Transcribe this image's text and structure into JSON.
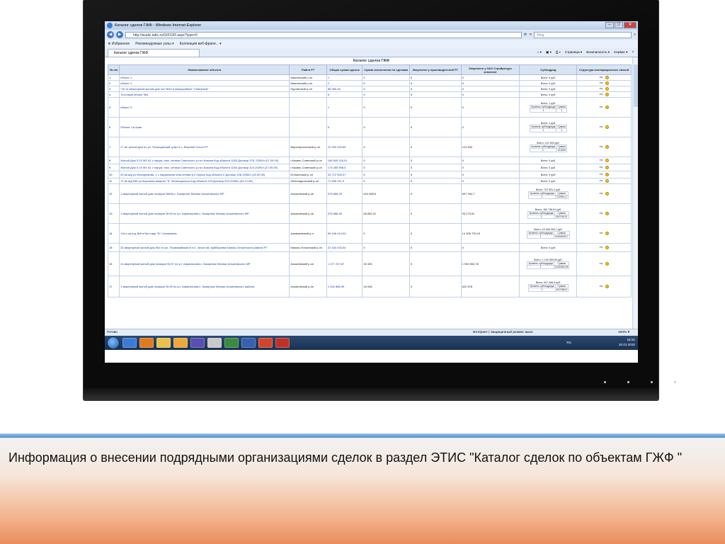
{
  "window": {
    "title": "Каталог сделок ГЖФ - Windows Internet Explorer",
    "min": "–",
    "max": "□",
    "close": "✕"
  },
  "address": {
    "url": "http://avalic.tattc.ru/GIF/GIF.aspx?type=0",
    "search_placeholder": "Bing"
  },
  "favorites": {
    "label": "Избранное",
    "item1": "Рекомендуемые узлы ▾",
    "item2": "Коллекция веб-фрагм... ▾"
  },
  "tab": {
    "label": "Каталог сделок ГЖФ"
  },
  "toolbar": {
    "page": "Страница ▾",
    "security": "Безопасность ▾",
    "service": "Сервис ▾"
  },
  "page_title": "Каталог сделок ГЖФ",
  "columns": [
    "№ п/п",
    "Наименование объекта",
    "Район РТ",
    "Общая сумма сделок",
    "Сумма исполнения по сделкам",
    "Закуплено у производителей РТ",
    "Закуплено у ЗАО Стройресурс комплект",
    "Субподряд",
    "Структура кооперационных связей"
  ],
  "rows": [
    {
      "n": "1",
      "name": "объект 1",
      "area": "Бавлинский р-он",
      "sum": "1",
      "exec": "0",
      "rt": "0",
      "zao": "0",
      "sub": "Всего: 0 руб."
    },
    {
      "n": "2",
      "name": "объект 2",
      "area": "Бавлинский р-он",
      "sum": "2",
      "exec": "0",
      "rt": "0",
      "zao": "0",
      "sub": "Всего: 0 руб."
    },
    {
      "n": "3",
      "name": "\"20-ти квартирный жилой дом поз №10 в микрорайоне \"Северный\"",
      "area": "Нурлатский р-он",
      "sum": "88 365,28",
      "exec": "0",
      "rt": "0",
      "zao": "0",
      "sub": "Всего: 0 руб."
    },
    {
      "n": "4",
      "name": "Тестовый объект №4",
      "area": "",
      "sum": "5",
      "exec": "0",
      "rt": "0",
      "zao": "0",
      "sub": "Всего: 0 руб."
    },
    {
      "n": "5",
      "name": "объект 3",
      "area": "",
      "sum": "1",
      "exec": "0",
      "rt": "0",
      "zao": "0",
      "sub": "Всего: 1 руб.",
      "level": "1",
      "amount": "1"
    },
    {
      "n": "6",
      "name": "Объект Са-ерия",
      "area": "",
      "sum": "5",
      "exec": "0",
      "rt": "0",
      "zao": "0",
      "sub": "Всего: 1 руб.",
      "level": "1",
      "amount": "1"
    },
    {
      "n": "7",
      "name": "27 кв. жилой дом по ул. Печищинский тракт в с. Верхний Услон РТ",
      "area": "Верхнеуслонский р-он",
      "sum": "22 993 339,69",
      "exec": "0",
      "rt": "0",
      "zao": "121 500",
      "sub": "Всего: 121 500 руб.",
      "level": "1",
      "amount": "121500"
    },
    {
      "n": "8",
      "name": "Жилой Дом 5-20 МЗ А1 с наруж. инж. сетями Советского р-на г.Казани Код объекта 1283 Договор 378 -2009/л (07.05.09)",
      "area": "г.Казань Советский р-он",
      "sum": "166 845 118,01",
      "exec": "0",
      "rt": "0",
      "zao": "0",
      "sub": "Всего: 0 руб."
    },
    {
      "n": "9",
      "name": "Жилой Дом 5-19 МЗ А1 с наруж. инж. сетями Советского р-на г.Казани Код объекта 1284 Договор 424-2009/л (27.05.09)",
      "area": "г.Казань Советский р-он",
      "sum": "173 285 598,6",
      "exec": "0",
      "rt": "0",
      "zao": "0",
      "sub": "Всего: 0 руб."
    },
    {
      "n": "10",
      "name": "40 кв.ж/д ул.Молодежная, 1 с наружными инж.сетями р.п.Уруссу Код объекта 2 Договор 108-2008/л (15.09.08)",
      "area": "Ютазинский р-он",
      "sum": "34 712 500,07",
      "exec": "0",
      "rt": "0",
      "zao": "0",
      "sub": "Всего: 0 руб."
    },
    {
      "n": "11",
      "name": "70 кв ж/д №4 ул.Королева квартал \"Б\" Зеленодольск Код объекта 139 Договор 202-2008/л (04.12.08)",
      "area": "Зеленодольский р-он",
      "sum": "71 556 257,9",
      "exec": "0",
      "rt": "0",
      "zao": "0",
      "sub": "Всего: 0 руб."
    },
    {
      "n": "12",
      "name": "1 квартирный жилой дом позиции №59а с. Базарные Матаки Алькеевского МР",
      "area": "Алькеевский р-он",
      "sum": "975 888,39",
      "exec": "624 088,5",
      "rt": "0",
      "zao": "697 994,7",
      "sub": "Всего: 722 591,2 руб.",
      "level": "1",
      "amount": "722591,2"
    },
    {
      "n": "13",
      "name": "1 квартирный жилой дом позиции № 53 по ул. Афанасьева с. Базарные Матаки Алькеевского МР",
      "area": "Алькеевский р-он",
      "sum": "975 888,39",
      "exec": "66 652,01",
      "rt": "0",
      "zao": "93 273,51",
      "sub": "Всего: 160 746,01 руб.",
      "level": "1",
      "amount": "160746,01"
    },
    {
      "n": "14",
      "name": "144-х кв.ж.д.№9 в Вост.мкр \"Б\" г.Азнакаево",
      "area": "Азнакаевский р-н",
      "sum": "99 448 414,93",
      "exec": "0",
      "rt": "0",
      "zao": "14 305 720,19",
      "sub": "Всего: 16 348 269,7 руб.",
      "level": "1",
      "amount": "16348269,7"
    },
    {
      "n": "15",
      "name": "32 квартирный жилой дом №1 по ул. Первомайская в н.п. Затон им. Куйбышева Камско-Устьинского района РТ",
      "area": "Камско-Устьинский р-он",
      "sum": "22 164 043,54",
      "exec": "0",
      "rt": "0",
      "zao": "0",
      "sub": "Всего: 0 руб."
    },
    {
      "n": "16",
      "name": "2х квартирный жилой дом позиции № 57 по ул. Афанасьева с. Базарные Матаки Алькеевского МР",
      "area": "Алькеевский р-он",
      "sum": "1 477 207,87",
      "exec": "30 326",
      "rt": "0",
      "zao": "1 054 560,76",
      "sub": "Всего: 1 139 369,95 руб.",
      "level": "1",
      "amount": "1139369,95"
    },
    {
      "n": "17",
      "name": "1 квартирный жилой дом позиции № 59 по ул. Афанасьева с. Базарные Матаки Алькеевского района",
      "area": "Алькеевский р-он",
      "sum": "1 002 888,39",
      "exec": "34 048",
      "rt": "0",
      "zao": "622 878",
      "sub": "Всего: 647 466,5 руб.",
      "level": "1",
      "amount": "647466,5"
    }
  ],
  "sub_headers": {
    "level": "Уровень субподряда",
    "amount": "Сумма"
  },
  "status": {
    "left": "Готово",
    "security": "Интернет | Защищенный режим: выкл.",
    "zoom": "100% ▾"
  },
  "tray": {
    "lang": "RU",
    "time": "18:31",
    "date": "20.01.2010"
  },
  "caption": "Информация о внесении подрядными организациями сделок в раздел ЭТИС \"Каталог сделок по объектам ГЖФ \"",
  "colors": {
    "accent": "#1e3b6d",
    "header_bg": "#d8e4f4",
    "taskbar": "#173152"
  }
}
